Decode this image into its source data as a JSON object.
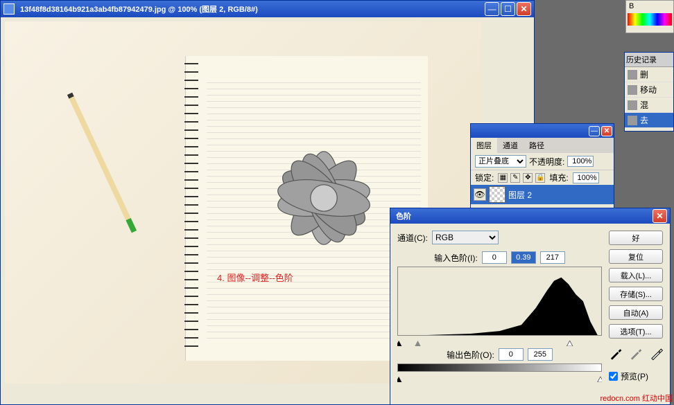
{
  "docWindow": {
    "title": "13f48f8d38164b921a3ab4fb87942479.jpg @ 100% (图层 2, RGB/8#)"
  },
  "annotation": "4. 图像--调整--色阶",
  "colorPanel": {
    "label": "B"
  },
  "historyPanel": {
    "tab": "历史记录",
    "items": [
      "删",
      "移动",
      "混",
      "去"
    ]
  },
  "layersPanel": {
    "tabs": [
      "图层",
      "通道",
      "路径"
    ],
    "blendMode": "正片叠底",
    "opacityLabel": "不透明度:",
    "opacity": "100%",
    "lockLabel": "锁定:",
    "fillLabel": "填充:",
    "fill": "100%",
    "activeLayer": "图层 2"
  },
  "levelsDialog": {
    "title": "色阶",
    "channelLabel": "通道(C):",
    "channel": "RGB",
    "inputLabel": "输入色阶(I):",
    "inputs": [
      "0",
      "0.39",
      "217"
    ],
    "outputLabel": "输出色阶(O):",
    "outputs": [
      "0",
      "255"
    ],
    "previewLabel": "预览(P)",
    "previewChecked": true,
    "buttons": {
      "ok": "好",
      "reset": "复位",
      "load": "载入(L)...",
      "save": "存储(S)...",
      "auto": "自动(A)",
      "options": "选项(T)..."
    }
  },
  "watermark": "redocn.com\n红动中国"
}
